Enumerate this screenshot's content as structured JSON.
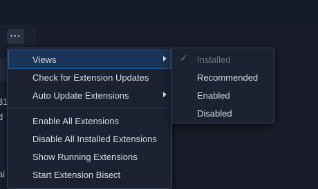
{
  "toolbar": {
    "more_button_label": "⋯"
  },
  "left_panel": {
    "partial_texts": [
      "31",
      "d",
      "ai"
    ]
  },
  "menu": {
    "items": [
      {
        "label": "Views",
        "has_submenu": true,
        "active": true
      },
      {
        "label": "Check for Extension Updates"
      },
      {
        "label": "Auto Update Extensions",
        "has_submenu": true
      },
      {
        "label": "Enable All Extensions"
      },
      {
        "label": "Disable All Installed Extensions"
      },
      {
        "label": "Show Running Extensions"
      },
      {
        "label": "Start Extension Bisect"
      }
    ]
  },
  "submenu": {
    "items": [
      {
        "label": "Installed",
        "checked": true,
        "disabled": true
      },
      {
        "label": "Recommended"
      },
      {
        "label": "Enabled"
      },
      {
        "label": "Disabled"
      }
    ]
  },
  "colors": {
    "background": "#181d29",
    "menu_bg": "#1c2232",
    "menu_border": "#3a4152",
    "active_bg": "#1b3558",
    "active_border": "#2a5aa0",
    "text": "#d6dae2",
    "disabled_text": "#6c7282"
  },
  "icons": [
    "more-icon",
    "chevron-right-icon",
    "checkmark-icon"
  ]
}
